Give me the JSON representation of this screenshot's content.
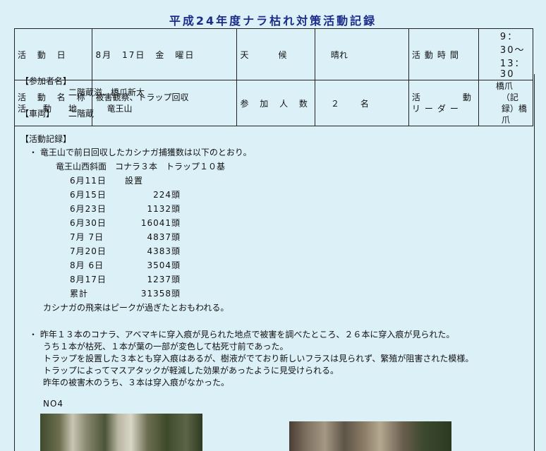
{
  "title": "平成24年度ナラ枯れ対策活動記録",
  "info": {
    "date_label": "活 動 日",
    "date_value": "8月　17日　金　曜日",
    "weather_label": "天　　候",
    "weather_value": "晴れ",
    "time_label": "活動時間",
    "time_value": "9：30〜13：30",
    "name_label": "活 動 名 称",
    "name_value": "被害観察、トラップ回収",
    "place_label": "活　動　地",
    "place_value": "竜王山",
    "count_label": "参 加 人 数",
    "count_value": "２　　名",
    "leader_label1": "活　　　動",
    "leader_label2": "リーダー",
    "leader_value1": "橋爪",
    "leader_value2": "（記録）橋爪"
  },
  "participants_header": "【参加者名】",
  "participants": "二階蔵滋、橋爪新太",
  "vehicle_header": "【車両】",
  "vehicle": "二階蔵",
  "record_header": "【活動記録】",
  "record_intro": "・ 竜王山で前日回収したカシナガ捕獲数は以下のとおり。",
  "record_subtitle": "竜王山西斜面　コナラ３本　トラップ１０基",
  "records": [
    {
      "date": "6月11日",
      "value": "設置",
      "unit": ""
    },
    {
      "date": "6月15日",
      "value": "224",
      "unit": "頭"
    },
    {
      "date": "6月23日",
      "value": "1132",
      "unit": "頭"
    },
    {
      "date": "6月30日",
      "value": "16041",
      "unit": "頭"
    },
    {
      "date": "7月 7日",
      "value": "4837",
      "unit": "頭"
    },
    {
      "date": "7月20日",
      "value": "4383",
      "unit": "頭"
    },
    {
      "date": "8月 6日",
      "value": "3504",
      "unit": "頭"
    },
    {
      "date": "8月17日",
      "value": "1237",
      "unit": "頭"
    },
    {
      "date": "累計",
      "value": "31358",
      "unit": "頭"
    }
  ],
  "record_note": "カシナガの飛来はピークが過ぎたとおもわれる。",
  "obs_lines": [
    "・ 昨年１３本のコナラ、アベマキに穿入痕が見られた地点で被害を調べたところ、２６本に穿入痕が見られた。",
    "うち１本が枯死、１本が葉の一部が変色して枯死寸前であった。",
    "トラップを設置した３本とも穿入痕はあるが、樹液がでており新しいフラスは見られず、繁殖が阻害された模様。",
    "トラップによってマスアタックが軽減した効果があったように見受けられる。",
    "昨年の被害木のうち、３本は穿入痕がなかった。"
  ],
  "photo_label": "NO4"
}
